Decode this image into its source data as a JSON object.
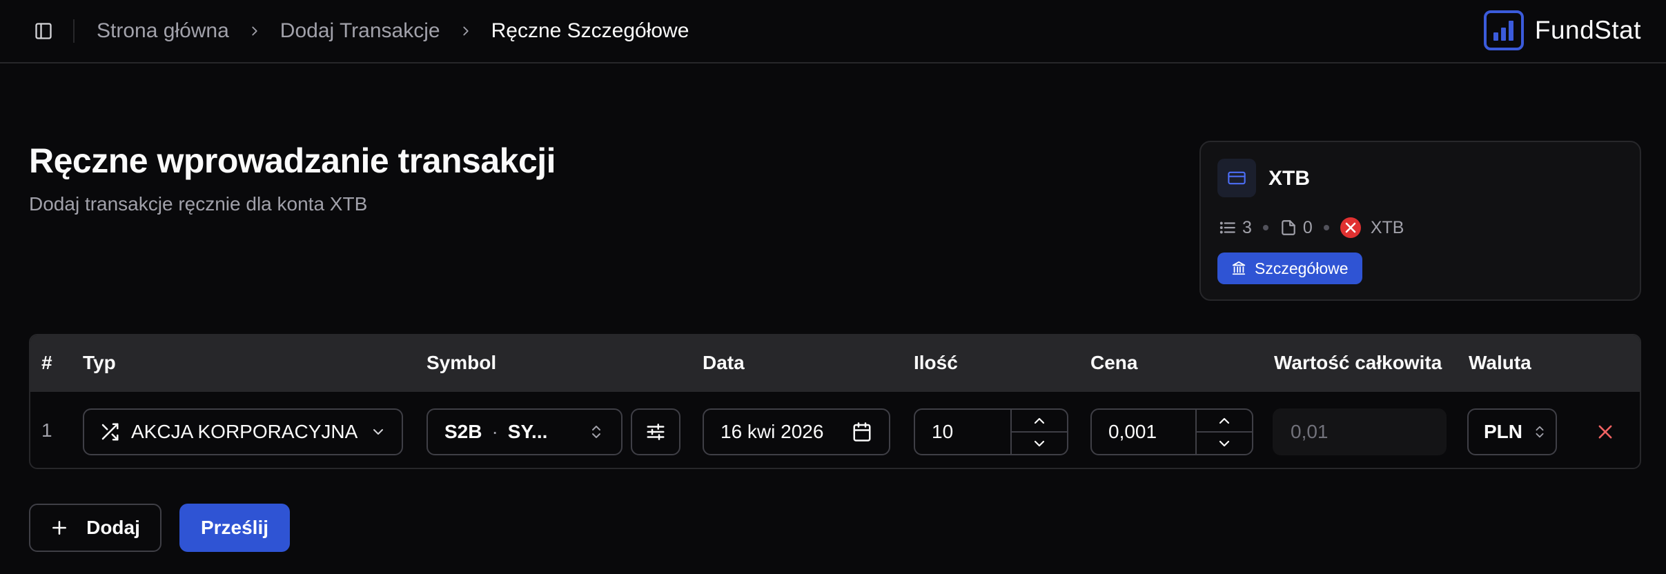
{
  "header": {
    "breadcrumb": [
      "Strona główna",
      "Dodaj Transakcje",
      "Ręczne Szczegółowe"
    ],
    "brand": "FundStat"
  },
  "page": {
    "title": "Ręczne wprowadzanie transakcji",
    "subtitle": "Dodaj transakcje ręcznie dla konta XTB"
  },
  "account": {
    "name": "XTB",
    "transactions_count": "3",
    "documents_count": "0",
    "broker": "XTB",
    "type_badge": "Szczegółowe"
  },
  "table": {
    "columns": [
      "#",
      "Typ",
      "Symbol",
      "Data",
      "Ilość",
      "Cena",
      "Wartość całkowita",
      "Waluta"
    ],
    "rows": [
      {
        "index": "1",
        "type": "AKCJA KORPORACYJNA",
        "symbol_code": "S2B",
        "symbol_name": "SY...",
        "date": "16 kwi 2026",
        "quantity": "10",
        "price": "0,001",
        "total": "0,01",
        "currency": "PLN"
      }
    ]
  },
  "actions": {
    "add_label": "Dodaj",
    "submit_label": "Prześlij"
  },
  "colors": {
    "background": "#09090b",
    "accent": "#2f54d4",
    "border": "#3f3f46",
    "danger": "#f06262",
    "broker_logo": "#e03131"
  }
}
